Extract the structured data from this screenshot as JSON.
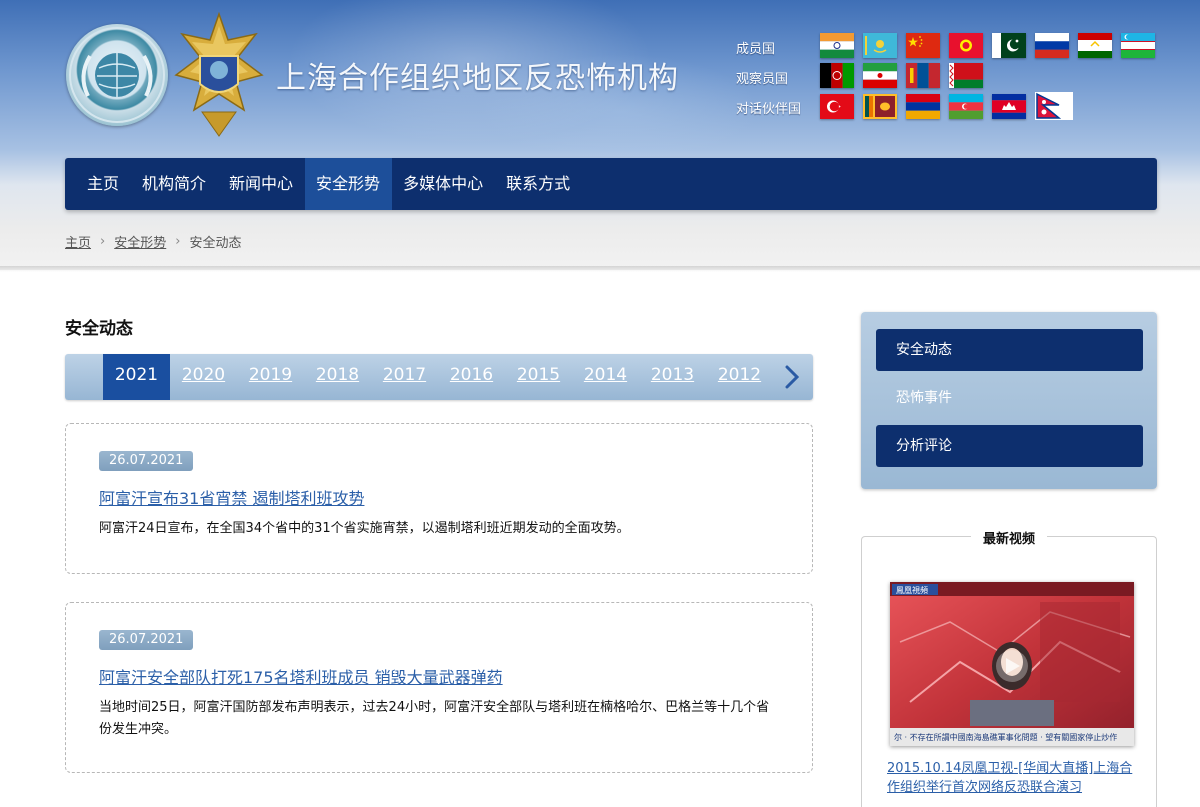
{
  "header": {
    "site_title": "上海合作组织地区反恐怖机构",
    "flag_groups": [
      {
        "label": "成员国",
        "flags": [
          "india-flag",
          "kazakhstan-flag",
          "china-flag",
          "kyrgyzstan-flag",
          "pakistan-flag",
          "russia-flag",
          "tajikistan-flag",
          "uzbekistan-flag"
        ]
      },
      {
        "label": "观察员国",
        "flags": [
          "afghanistan-flag",
          "iran-flag",
          "mongolia-flag",
          "belarus-flag"
        ]
      },
      {
        "label": "对话伙伴国",
        "flags": [
          "turkey-flag",
          "sri-lanka-flag",
          "armenia-flag",
          "azerbaijan-flag",
          "cambodia-flag",
          "nepal-flag"
        ]
      }
    ]
  },
  "nav": {
    "items": [
      {
        "label": "主页"
      },
      {
        "label": "机构简介"
      },
      {
        "label": "新闻中心"
      },
      {
        "label": "安全形势",
        "active": true
      },
      {
        "label": "多媒体中心"
      },
      {
        "label": "联系方式"
      }
    ]
  },
  "breadcrumb": {
    "home": "主页",
    "section": "安全形势",
    "current": "安全动态",
    "separator": "›"
  },
  "main": {
    "title": "安全动态",
    "years": [
      "2021",
      "2020",
      "2019",
      "2018",
      "2017",
      "2016",
      "2015",
      "2014",
      "2013",
      "2012"
    ],
    "active_year": "2021",
    "news": [
      {
        "date": "26.07.2021",
        "title": "阿富汗宣布31省宵禁 遏制塔利班攻势",
        "summary": "阿富汗24日宣布，在全国34个省中的31个省实施宵禁，以遏制塔利班近期发动的全面攻势。"
      },
      {
        "date": "26.07.2021",
        "title": "阿富汗安全部队打死175名塔利班成员 销毁大量武器弹药",
        "summary": "当地时间25日，阿富汗国防部发布声明表示，过去24小时，阿富汗安全部队与塔利班在楠格哈尔、巴格兰等十几个省份发生冲突。"
      }
    ]
  },
  "sidebar": {
    "menu": [
      {
        "label": "安全动态",
        "filled": true
      },
      {
        "label": "恐怖事件",
        "filled": false
      },
      {
        "label": "分析评论",
        "filled": true
      }
    ],
    "video": {
      "heading": "最新视频",
      "caption": "2015.10.14凤凰卫视-[华闻大直播]上海合作组织举行首次网络反恐联合演习",
      "thumb_badge": "鳳凰視頻",
      "ticker": "尔 · 不存在所謂中國南海島礁軍事化問題 · 望有關國家停止炒作"
    }
  },
  "colors": {
    "nav_bg": "#0d2f6e",
    "nav_active": "#1d4f9a",
    "link": "#2b5fa8",
    "year_active": "#1a4fa0"
  }
}
